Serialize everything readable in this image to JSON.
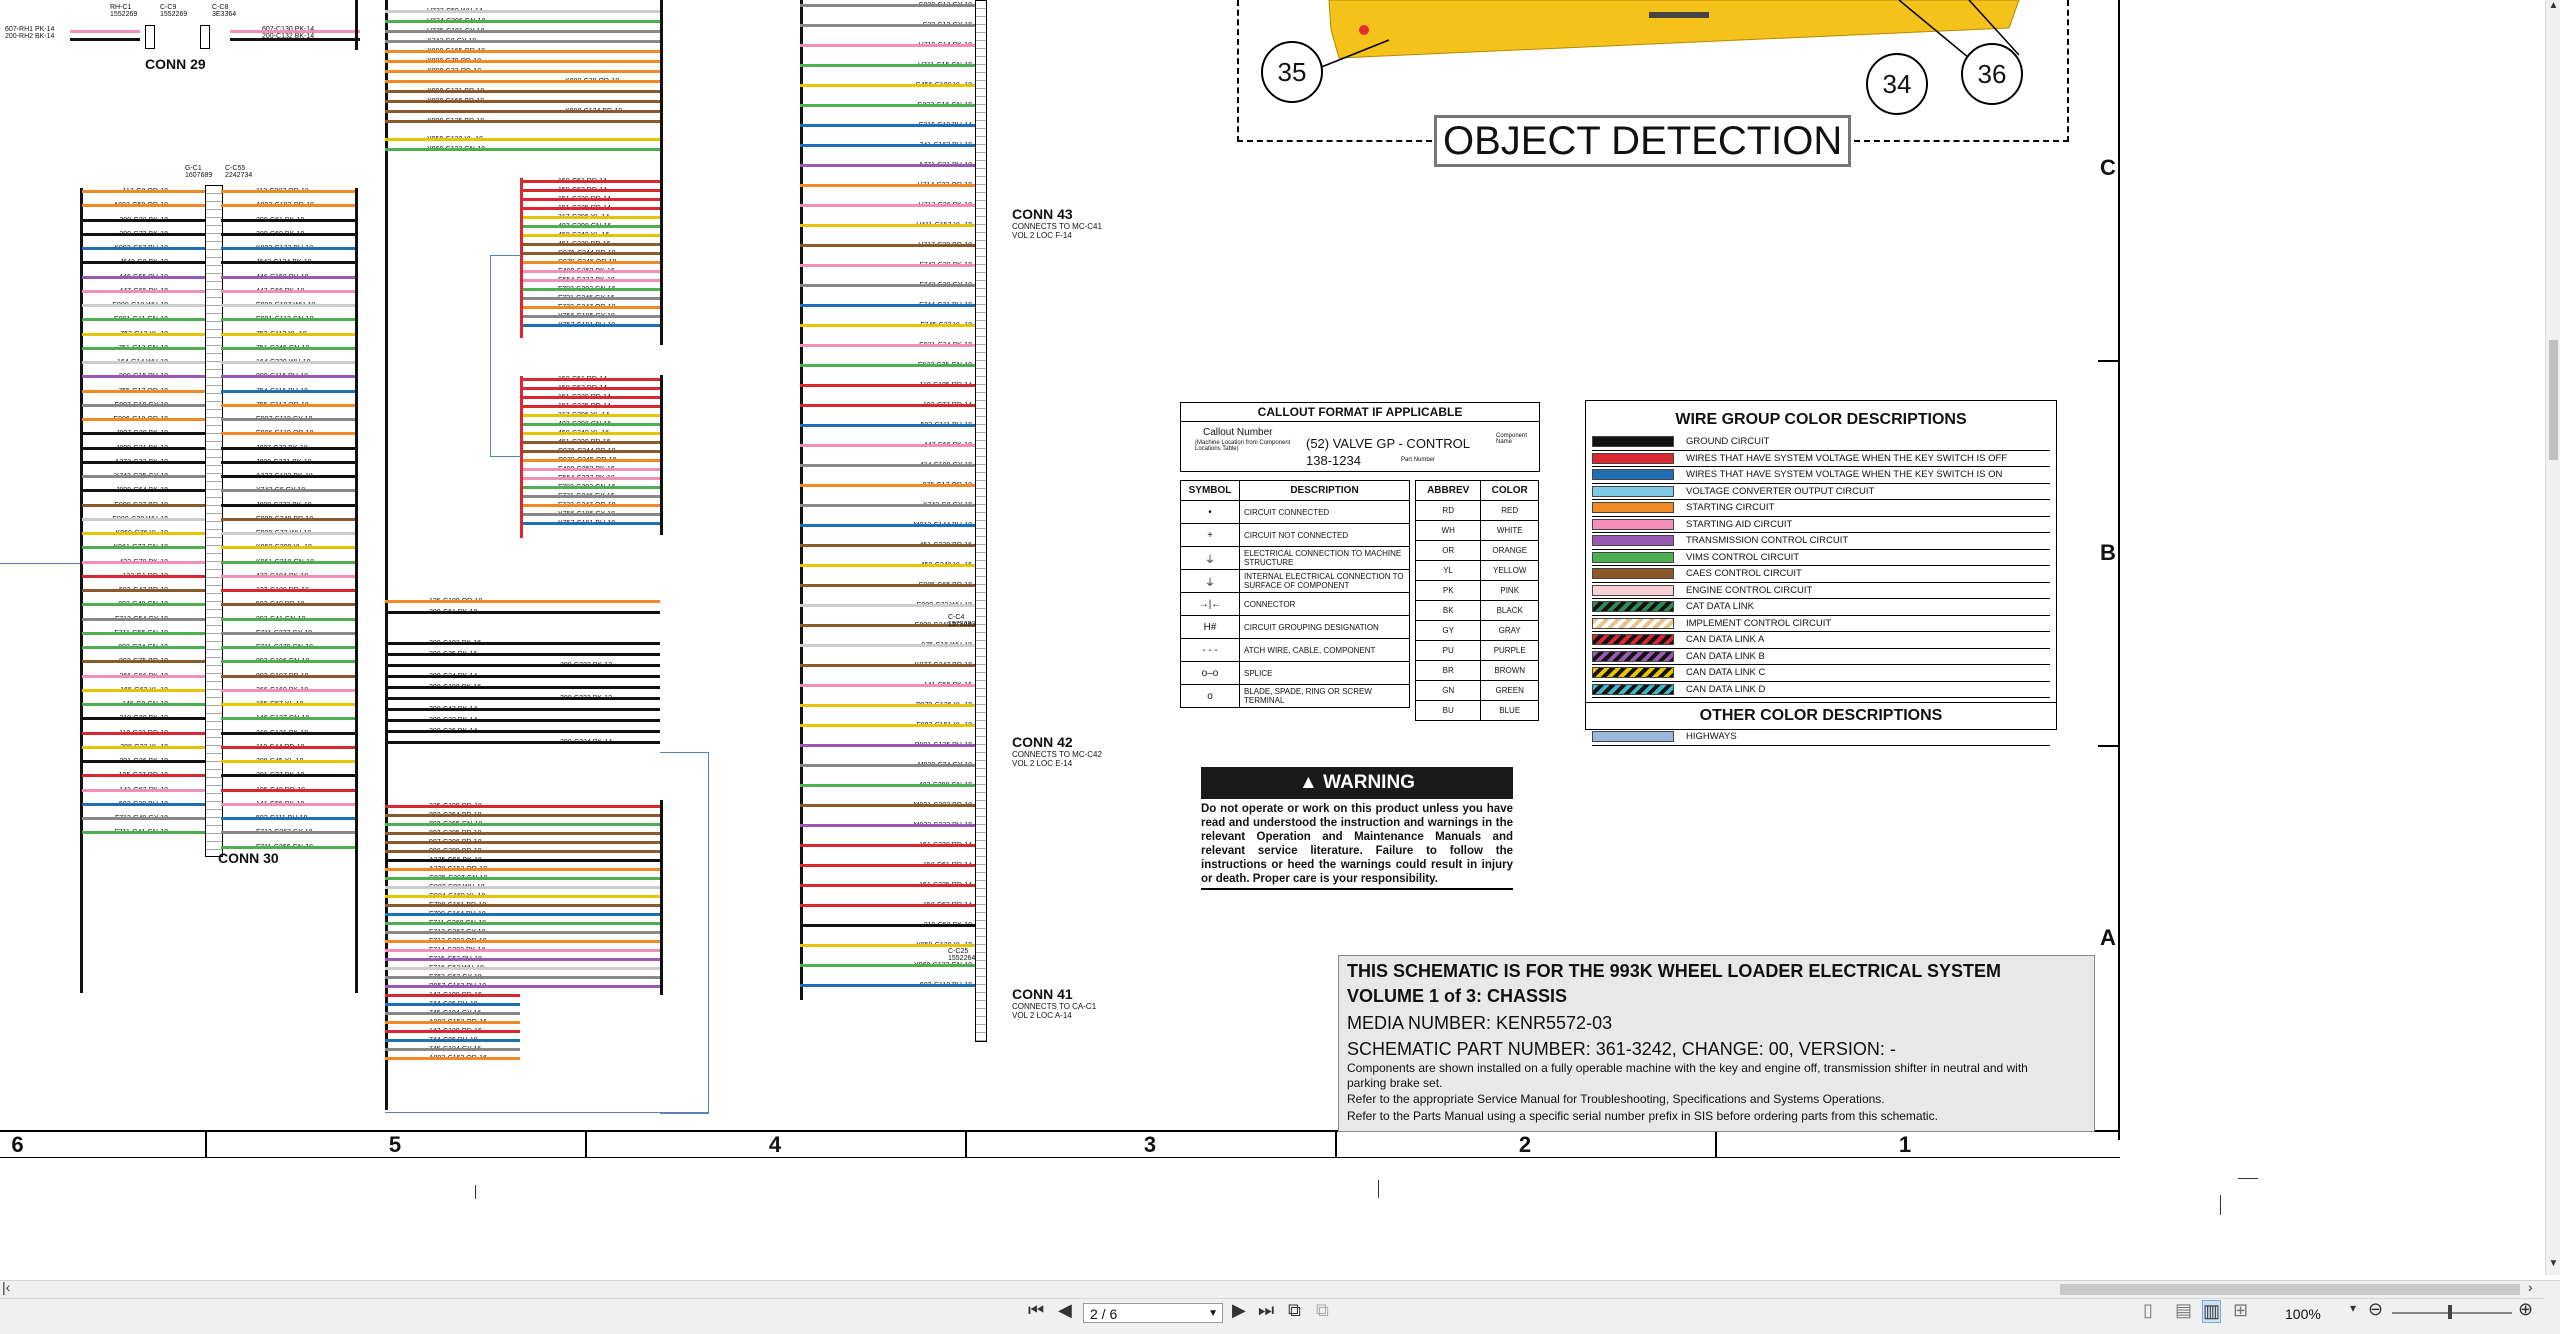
{
  "object_detection": {
    "title": "OBJECT DETECTION",
    "callouts": [
      "35",
      "34",
      "36"
    ]
  },
  "connectors": {
    "conn29": "CONN 29",
    "conn30": "CONN 30",
    "conn43": {
      "name": "CONN 43",
      "sub1": "CONNECTS TO MC-C41",
      "sub2": "VOL 2 LOC F-14"
    },
    "conn42": {
      "name": "CONN 42",
      "sub1": "CONNECTS TO MC-C42",
      "sub2": "VOL 2 LOC E-14"
    },
    "conn41": {
      "name": "CONN 41",
      "sub1": "CONNECTS TO CA-C1",
      "sub2": "VOL 2 LOC A-14"
    },
    "tags": [
      "RH-C1\n1552269",
      "C-C9\n1552269",
      "C-C8\n3E3364",
      "G-C1\n1607689",
      "C-C55\n2242734",
      "C-C4\n1573693",
      "C-C25\n1552264"
    ]
  },
  "wires_left": [
    "113-G8 OR-18",
    "A893-G59 OR-18",
    "200-G38 BK-18",
    "200-G73 BK-18",
    "K983-G67 BU-18",
    "J642-G8 BK-18",
    "446-G65 PU-18",
    "447-G65 PK-18",
    "E900-G10 WH-18",
    "E901-G11 GN-18",
    "752-G12 YL-18",
    "751-G13 GN-18",
    "164-G14 WH-18",
    "800-G15 PU-18",
    "755-G17 OR-18",
    "E907-G18 GY-18",
    "E906-G19 OR-18",
    "J807-G20 BK-18",
    "J809-G21 BK-18",
    "A273-G23 BK-18",
    "X743-G25 GY-18",
    "J808-G64 BK-18",
    "E908-G27 BR-18",
    "E909-G28 WH-18",
    "K960-G76 YL-18",
    "K961-G77 GN-18",
    "432-G78 PK-18",
    "123-G1 RD-18",
    "592-G47 BR-18",
    "893-G48 GN-18",
    "F712-G54 GY-18",
    "F711-G55 GN-18",
    "893-G74 GN-18",
    "892-G75 BR-18",
    "366-G66 PK-18",
    "165-G63 YL-18",
    "146-G9 GN-18",
    "210-G30 BK-18",
    "110-G32 RD-18",
    "308-G33 YL-18",
    "201-G36 BK-18",
    "105-G37 RD-18",
    "141-G62 PK-18",
    "592-G39 BU-18",
    "F712-G40 GY-18",
    "F711-G41 GN-18"
  ],
  "wires_mid_left": [
    "113-C207 OR-18",
    "A893-C182 OR-18",
    "200-C61 BK-18",
    "200-C60 BK-18",
    "K983-C133 BU-18",
    "J642-C134 BK-18",
    "446-C159 PU-18",
    "447-C66 PK-18",
    "E900-C107 WH-18",
    "E901-C112 GN-18",
    "752-C113 YL-18",
    "751-C246 GN-18",
    "164-C339 WH-18",
    "800-C115 PU-18",
    "754-C116 BU-18",
    "755-C117 OR-18",
    "E907-C118 GY-18",
    "E906-C119 OR-18",
    "J807-C73 BK-18",
    "J809-C271 BK-18",
    "A273-C103 BK-18",
    "X743-C6 GY-18",
    "J808-C272 BK-18",
    "E908-C348 BR-18",
    "E909-C72 WH-18",
    "K960-C209 YL-18",
    "K961-C210 GN-18",
    "432-C184 PK-18",
    "123-C100 RD-18",
    "592-C40 BR-18",
    "893-C41 GN-18",
    "F711-C277 GY-18",
    "F711-C278 GN-18",
    "893-C196 GN-18",
    "892-C197 BR-18",
    "366-C160 PK-18",
    "165-C57 YL-18",
    "146-C127 GN-18",
    "210-C121 BK-18",
    "110-C44 RD-18",
    "308-C45 YL-18",
    "201-C37 BK-18",
    "105-C48 RD-18",
    "141-C55 PK-18",
    "592-C111 BU-18",
    "F712-C267 GY-18",
    "F711-C266 GN-18"
  ],
  "wires_col5_top": [
    "U733-C59 WH-14",
    "U734-C206 GN-18",
    "U735-C181 GY-18",
    "X743-C8 GY-18",
    "X800-C165 OR-18",
    "X800-C70 OR-18",
    "X800-C33 OR-18",
    "X800-C38 OR-18",
    "X998-C131 BR-18",
    "X998-C166 BR-18",
    "X998-C124 BR-18",
    "X999-C125 BR-18",
    "Y959-C120 YL-18",
    "Y960-C122 GN-18"
  ],
  "wires_col5_bottom": [
    "125-C198 OR-18",
    "200-C61 BK-18",
    "200-C102 BK-16",
    "200-C35 BK-16",
    "200-C332 BK-12",
    "200-C24 BK-14",
    "200-C198 BK-16",
    "200-C333 BK-12",
    "200-C43 BK-14",
    "200-C32 BK-14",
    "200-C36 BK-14",
    "200-C334 BK-14",
    "325-C199 RD-18",
    "892-C264 BR-18",
    "893-C265 GN-18",
    "893-C305 BR-18",
    "997-C306 BR-18",
    "998-C289 BR-18",
    "A275-C56 BK-18",
    "A720-C153 OR-18",
    "C835-C307 GN-18",
    "C983-C88 WH-18",
    "C984-C169 YL-18",
    "E799-C161 BR-18",
    "F700-C164 BU-18",
    "F711-C268 GN-18",
    "F712-C267 GY-18",
    "F713-C302 OR-18",
    "F714-C303 PK-18",
    "F715-C52 PU-18",
    "F716-C63 WH-18",
    "F762-C62 GY-18",
    "P957-C163 PU-18",
    "143-C109 RD-16",
    "744-C86 BU-18",
    "745-C104 GY-16",
    "A893-C152 OR-16",
    "143-C109 RD-16",
    "744-C86 BU-18",
    "745-C104 GY-16",
    "A893-C152 OR-16"
  ],
  "wires_col4": [
    "C829-C12 GY-18",
    "C22-C13 GY-18",
    "H710-C14 PK-18",
    "H711-C15 GN-18",
    "G456-C180 YL-18",
    "C832-C16 GN-18",
    "E316-C19 BU-14",
    "341-C163 BU-18",
    "A771-C21 PU-18",
    "H714-C22 OR-18",
    "H713-C26 PK-18",
    "H411-C153 YL-18",
    "H717-C28 BR-18",
    "F742-C29 PK-18",
    "F743-C30 GY-18",
    "F744-C31 BU-18",
    "F745-C32 YL-18",
    "E921-C34 PK-18",
    "E922-C35 GN-18",
    "110-C105 RD-14",
    "102-C77 RD-14",
    "592-C111 BU-18",
    "447-C66 PK-18",
    "424-C189 GY-18",
    "976-C17 OR-18",
    "X743-C8 GY-18",
    "M912-C144 BU-18",
    "451-C239 BR-16",
    "450-C240 YL-16",
    "E985-C65 BR-18",
    "E909-C72 WH-18",
    "E908-C348 BR-18",
    "975-C16 WH-18",
    "K977-C347 BR-18",
    "141-C55 PK-16",
    "P979-C126 YL-18",
    "F882-C151 YL-18",
    "P981-C135 PU-18",
    "M920-C74 GY-18",
    "403-C298 GN-18",
    "M921-C203 BR-18",
    "M923-C232 PU-18",
    "151-C330 RD-14",
    "150-C51 RD-14",
    "151-C335 RD-14",
    "150-C52 RD-14",
    "210-C59 BK-18",
    "Y959-C120 YL-18",
    "Y960-C122 GN-18",
    "592-C110 BU-18"
  ],
  "callout_format": {
    "header": "CALLOUT FORMAT IF APPLICABLE",
    "callout_number": "Callout Number",
    "callout_note": "(Machine Location from Component Locations Table)",
    "example": "(52) VALVE GP - CONTROL",
    "part": "138-1234",
    "component_name": "Component Name",
    "part_number": "Part Number"
  },
  "symbol_table": {
    "headers": [
      "SYMBOL",
      "DESCRIPTION"
    ],
    "rows": [
      {
        "symbol": "•",
        "desc": "CIRCUIT CONNECTED"
      },
      {
        "symbol": "+",
        "desc": "CIRCUIT NOT CONNECTED"
      },
      {
        "symbol": "⏚",
        "desc": "ELECTRICAL CONNECTION TO MACHINE STRUCTURE"
      },
      {
        "symbol": "⏚",
        "desc": "INTERNAL ELECTRICAL CONNECTION TO SURFACE OF COMPONENT"
      },
      {
        "symbol": "→|←",
        "desc": "CONNECTOR"
      },
      {
        "symbol": "H#",
        "desc": "CIRCUIT GROUPING DESIGNATION"
      },
      {
        "symbol": "- - -",
        "desc": "ATCH WIRE, CABLE, COMPONENT"
      },
      {
        "symbol": "o–o",
        "desc": "SPLICE"
      },
      {
        "symbol": "o",
        "desc": "BLADE, SPADE, RING OR SCREW TERMINAL"
      }
    ]
  },
  "abbrev_table": {
    "headers": [
      "ABBREV",
      "COLOR"
    ],
    "rows": [
      [
        "RD",
        "RED"
      ],
      [
        "WH",
        "WHITE"
      ],
      [
        "OR",
        "ORANGE"
      ],
      [
        "YL",
        "YELLOW"
      ],
      [
        "PK",
        "PINK"
      ],
      [
        "BK",
        "BLACK"
      ],
      [
        "GY",
        "GRAY"
      ],
      [
        "PU",
        "PURPLE"
      ],
      [
        "BR",
        "BROWN"
      ],
      [
        "GN",
        "GREEN"
      ],
      [
        "BU",
        "BLUE"
      ]
    ]
  },
  "wire_group": {
    "title": "WIRE GROUP COLOR DESCRIPTIONS",
    "rows": [
      {
        "color": "#111111",
        "label": "GROUND CIRCUIT"
      },
      {
        "color": "#d9282f",
        "label": "WIRES THAT HAVE SYSTEM VOLTAGE WHEN THE KEY SWITCH IS OFF"
      },
      {
        "color": "#1f6fb5",
        "label": "WIRES THAT HAVE SYSTEM VOLTAGE WHEN THE KEY SWITCH IS ON"
      },
      {
        "color": "#7fc9e6",
        "label": "VOLTAGE CONVERTER OUTPUT CIRCUIT"
      },
      {
        "color": "#f08a24",
        "label": "STARTING CIRCUIT"
      },
      {
        "color": "#f28fb8",
        "label": "STARTING AID CIRCUIT"
      },
      {
        "color": "#9b59b6",
        "label": "TRANSMISSION CONTROL CIRCUIT"
      },
      {
        "color": "#4caf50",
        "label": "VIMS CONTROL CIRCUIT"
      },
      {
        "color": "#8b5a2b",
        "label": "CAES CONTROL CIRCUIT"
      },
      {
        "color": "#f9d0d8",
        "label": "ENGINE CONTROL CIRCUIT"
      },
      {
        "color": "stripe-green",
        "label": "CAT DATA LINK"
      },
      {
        "color": "stripe-tan",
        "label": "IMPLEMENT CONTROL CIRCUIT"
      },
      {
        "color": "stripe-red",
        "label": "CAN DATA LINK A"
      },
      {
        "color": "stripe-purple",
        "label": "CAN DATA LINK B"
      },
      {
        "color": "stripe-yellow",
        "label": "CAN DATA LINK C"
      },
      {
        "color": "stripe-cyan",
        "label": "CAN DATA LINK D"
      }
    ],
    "other_title": "OTHER COLOR DESCRIPTIONS",
    "other_rows": [
      {
        "color": "#9db8dc",
        "label": "HIGHWAYS"
      }
    ]
  },
  "warning": {
    "title": "WARNING",
    "text": "Do not operate or work on this product unless you have read and understood the instruction and warnings in the relevant Operation and Maintenance Manuals and relevant service literature. Failure to follow the instructions or heed the warnings could result in injury or death. Proper care is your responsibility."
  },
  "title_block": {
    "line1": "THIS SCHEMATIC IS FOR THE 993K WHEEL LOADER ELECTRICAL SYSTEM",
    "line2": "VOLUME 1 of 3: CHASSIS",
    "media": "MEDIA NUMBER: KENR5572-03",
    "part": "SCHEMATIC PART NUMBER: 361-3242, CHANGE: 00, VERSION: -",
    "note1": "Components are shown installed on a fully operable machine with the key and engine off, transmission shifter in neutral and with parking brake set.",
    "note2": "Refer to the appropriate Service Manual for Troubleshooting, Specifications and Systems Operations.",
    "note3": "Refer to the Parts Manual using a specific serial number prefix in SIS before ordering parts from this schematic."
  },
  "zones": [
    "6",
    "5",
    "4",
    "3",
    "2",
    "1"
  ],
  "side_letters": [
    "C",
    "B",
    "A"
  ],
  "toolbar": {
    "page_value": "2 / 6",
    "zoom": "100%"
  }
}
